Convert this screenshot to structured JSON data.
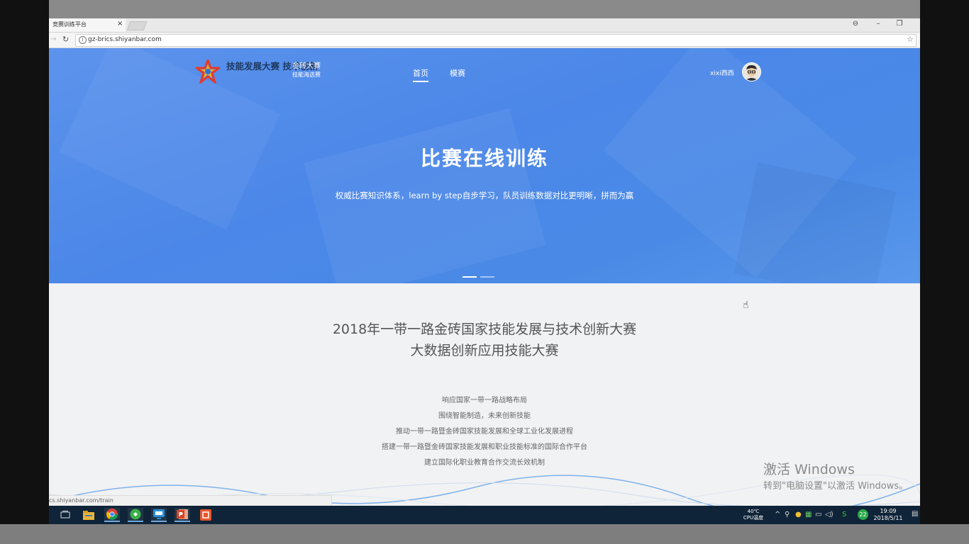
{
  "browser": {
    "tab_title": "竞赛训练平台",
    "tab_close": "×",
    "url": "gz-brics.shiyanbar.com",
    "status_url": "cs.shiyanbar.com/train",
    "controls": {
      "account": "⊖",
      "minimize": "–",
      "restore": "❐"
    }
  },
  "site": {
    "logo_cn": "技能发展大赛 技术创新",
    "logo_sub_line1": "金砖大赛",
    "logo_sub_line2": "技能海选赛",
    "nav": [
      "首页",
      "模赛"
    ],
    "user_name": "xixi西西"
  },
  "hero": {
    "title": "比赛在线训练",
    "subtitle": "权威比赛知识体系，learn by step自步学习，队员训练数据对比更明晰，拼而为赢"
  },
  "section": {
    "title_line1": "2018年一带一路金砖国家技能发展与技术创新大赛",
    "title_line2": "大数据创新应用技能大赛",
    "items": [
      "响应国家一带一路战略布局",
      "围绕智能制造，未来创新技能",
      "推动一带一路暨金砖国家技能发展和全球工业化发展进程",
      "搭建一带一路暨金砖国家技能发展和职业技能标准的国际合作平台",
      "建立国际化职业教育合作交流长效机制"
    ]
  },
  "watermark": {
    "line1": "激活 Windows",
    "line2": "转到\"电脑设置\"以激活 Windows。"
  },
  "taskbar": {
    "temp": "40℃",
    "temp_label": "CPU温度",
    "badge_count": "22",
    "time": "19:09",
    "date": "2018/5/11"
  }
}
